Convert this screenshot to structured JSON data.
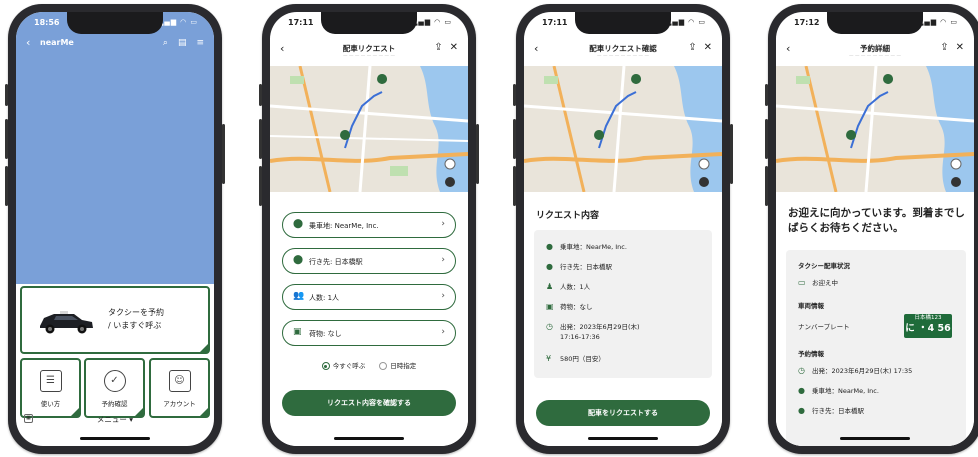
{
  "colors": {
    "brand_green": "#2f6b3e",
    "map_sky": "#7aa0d8",
    "plate_green": "#1f6b3a"
  },
  "phone1": {
    "time": "18:56",
    "brand": "nearMe",
    "book_tile": {
      "line1": "タクシーを予約",
      "line2": "/ いますぐ呼ぶ"
    },
    "tiles": [
      {
        "label": "使い方",
        "icon": "list-icon"
      },
      {
        "label": "予約確認",
        "icon": "check-icon"
      },
      {
        "label": "アカウント",
        "icon": "profile-icon"
      }
    ],
    "menu": "メニュー"
  },
  "phone2": {
    "time": "17:11",
    "title": "配車リクエスト",
    "rows": [
      {
        "icon": "pin-icon",
        "label": "乗車地: NearMe, Inc."
      },
      {
        "icon": "pin-icon",
        "label": "行き先: 日本橋駅"
      },
      {
        "icon": "people-icon",
        "label": "人数: 1人"
      },
      {
        "icon": "luggage-icon",
        "label": "荷物: なし"
      }
    ],
    "radio_now": "今すぐ呼ぶ",
    "radio_later": "日時指定",
    "cta": "リクエスト内容を確認する"
  },
  "phone3": {
    "time": "17:11",
    "title": "配車リクエスト確認",
    "section": "リクエスト内容",
    "items": [
      {
        "icon": "pin-icon",
        "text": "乗車地：NearMe, Inc."
      },
      {
        "icon": "pin-icon",
        "text": "行き先：日本橋駅"
      },
      {
        "icon": "people-icon",
        "text": "人数：1人"
      },
      {
        "icon": "luggage-icon",
        "text": "荷物：なし"
      },
      {
        "icon": "clock-icon",
        "text": "出発：2023年6月29日(木)",
        "text2": "17:16-17:36"
      },
      {
        "icon": "yen-icon",
        "text": "580円（目安）"
      }
    ],
    "cta": "配車をリクエストする"
  },
  "phone4": {
    "time": "17:12",
    "title": "予約詳細",
    "headline": "お迎えに向かっています。到着までしばらくお待ちください。",
    "status_label": "タクシー配車状況",
    "status_value": "お迎え中",
    "vehicle_label": "車両情報",
    "plate_label": "ナンバープレート",
    "plate_top": "日本橋123",
    "plate_num": "に ・4 56",
    "reservation_label": "予約情報",
    "res_items": [
      {
        "icon": "clock-icon",
        "text": "出発：2023年6月29日(木) 17:35"
      },
      {
        "icon": "pin-icon",
        "text": "乗車地：NearMe, Inc."
      },
      {
        "icon": "pin-icon",
        "text": "行き先：日本橋駅"
      }
    ]
  }
}
